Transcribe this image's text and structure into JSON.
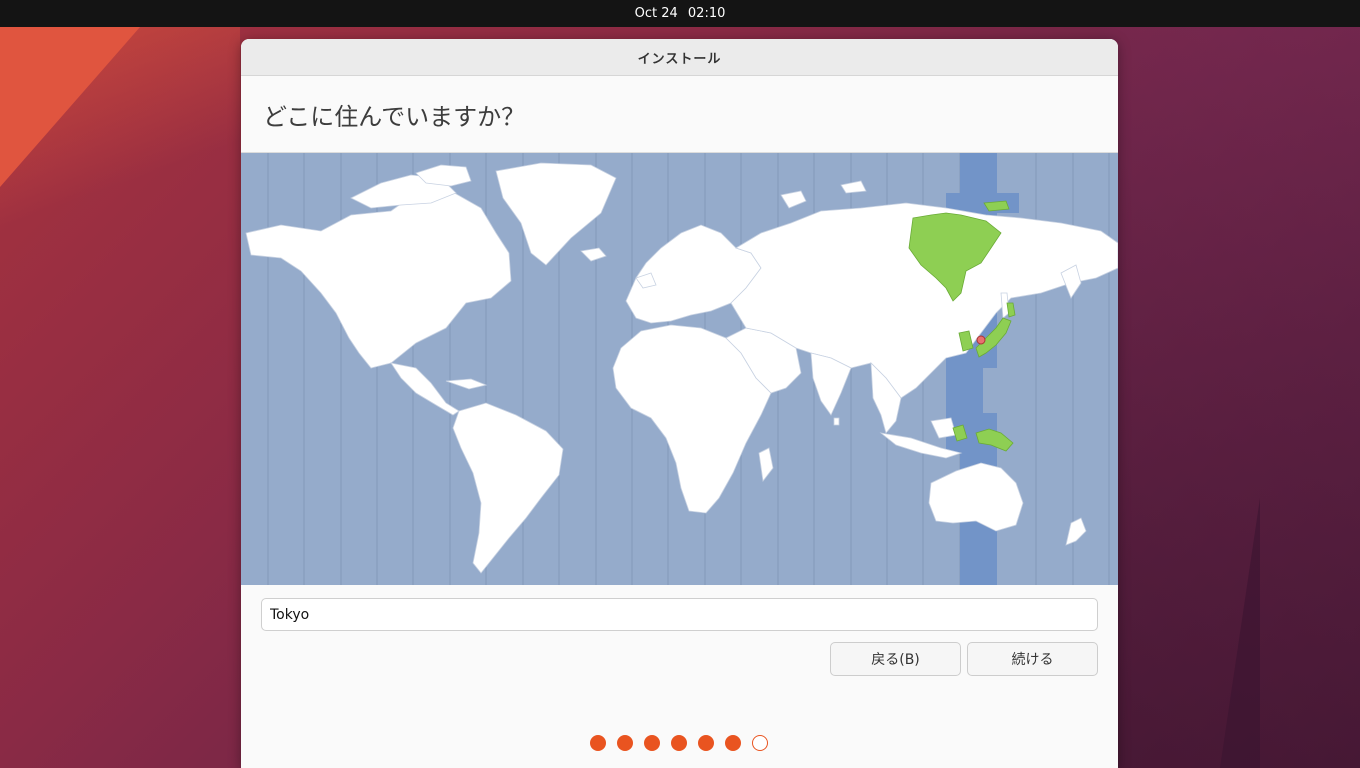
{
  "topbar": {
    "date": "Oct 24",
    "time": "02:10"
  },
  "window": {
    "title": "インストール",
    "heading": "どこに住んでいますか？",
    "timezone_input": {
      "value": "Tokyo",
      "placeholder": ""
    },
    "buttons": {
      "back": "戻る(B)",
      "continue": "続ける"
    },
    "progress": {
      "total_steps": 7,
      "completed_steps": 6
    }
  },
  "map": {
    "selected_city": "Tokyo",
    "colors": {
      "ocean": "#95abcb",
      "land": "#ffffff",
      "selected_zone": "#7092c7",
      "selected_land": "#8ecf53",
      "marker": "#e87070"
    }
  },
  "colors": {
    "accent": "#e95420"
  }
}
